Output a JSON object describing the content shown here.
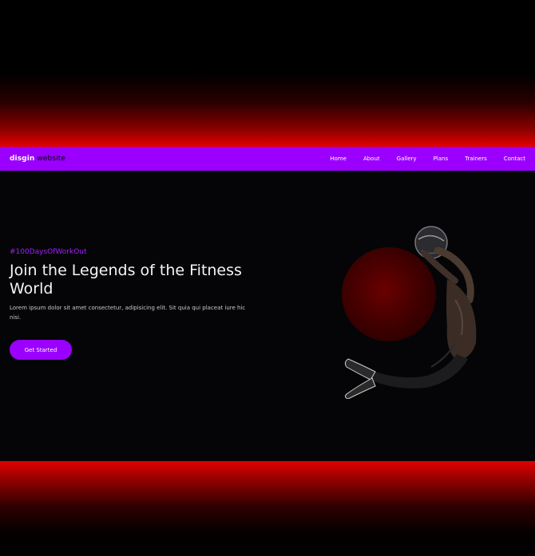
{
  "brand": {
    "name": "disgin",
    "accent": "website"
  },
  "nav": {
    "items": [
      {
        "label": "Home",
        "active": true
      },
      {
        "label": "About",
        "active": false
      },
      {
        "label": "Gallery",
        "active": false
      },
      {
        "label": "Plans",
        "active": false
      },
      {
        "label": "Trainers",
        "active": false
      },
      {
        "label": "Contact",
        "active": false
      }
    ]
  },
  "hero": {
    "hashtag": "#100DaysOfWorkOut",
    "title": "Join the Legends of the Fitness World",
    "description": "Lorem ipsum dolor sit amet consectetur, adipisicing elit. Sit quia qui placeat iure hic nisi.",
    "cta_label": "Get Started"
  },
  "colors": {
    "accent": "#9b00ff",
    "hashtag": "#a020ff",
    "glow_red": "#e40000",
    "background": "#050505"
  }
}
